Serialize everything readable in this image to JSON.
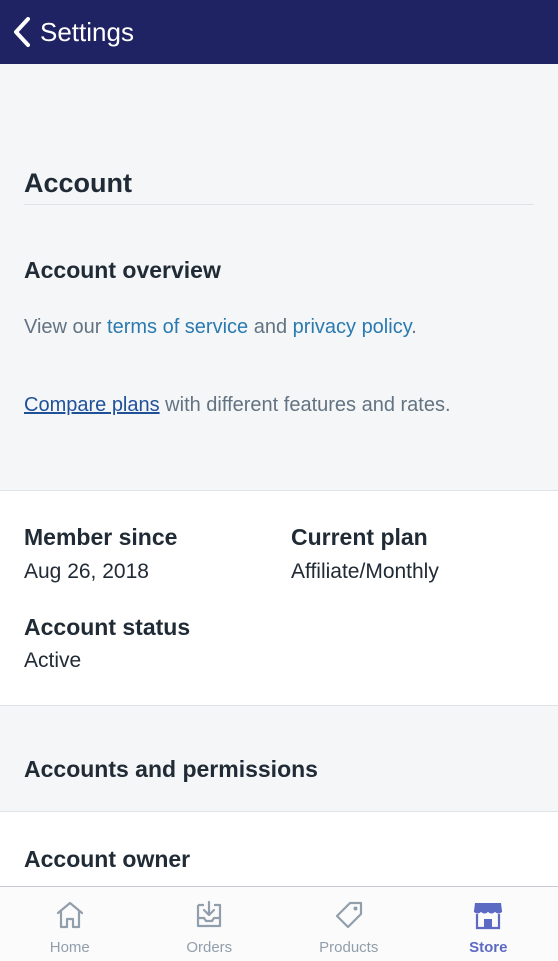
{
  "header": {
    "title": "Settings"
  },
  "account": {
    "section_title": "Account",
    "overview_title": "Account overview",
    "overview_prefix": "View our ",
    "terms_link": "terms of service",
    "and_text": " and ",
    "privacy_link": "privacy policy",
    "period": ".",
    "compare_link": "Compare plans",
    "compare_suffix": " with different features and rates."
  },
  "info": {
    "member_since_label": "Member since",
    "member_since_value": "Aug 26, 2018",
    "current_plan_label": "Current plan",
    "current_plan_value": "Affiliate/Monthly",
    "status_label": "Account status",
    "status_value": "Active"
  },
  "permissions": {
    "title": "Accounts and permissions",
    "owner_title": "Account owner"
  },
  "tabs": [
    {
      "label": "Home",
      "icon": "home-icon"
    },
    {
      "label": "Orders",
      "icon": "orders-icon"
    },
    {
      "label": "Products",
      "icon": "tag-icon"
    },
    {
      "label": "Store",
      "icon": "store-icon",
      "active": true
    }
  ],
  "colors": {
    "header_bg": "#1f2263",
    "link": "#2a7ab0",
    "active_tab": "#5c6ac4",
    "inactive_tab": "#919eab"
  }
}
